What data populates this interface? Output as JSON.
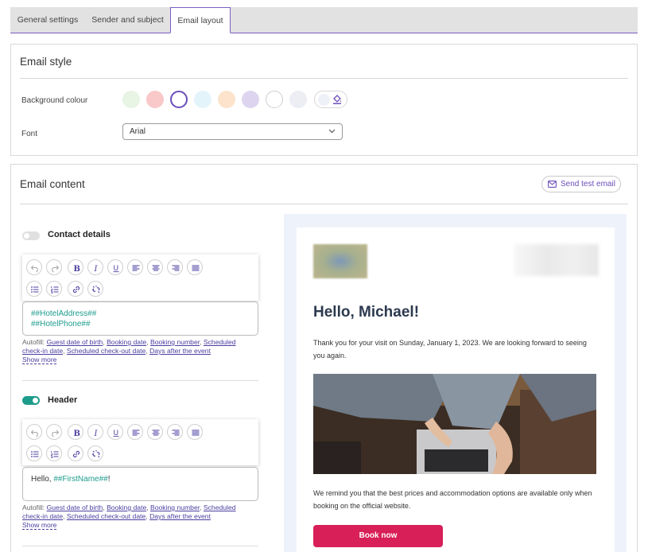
{
  "tabs": [
    {
      "label": "General settings"
    },
    {
      "label": "Sender and subject"
    },
    {
      "label": "Email layout"
    }
  ],
  "email_style": {
    "title": "Email style",
    "background_label": "Background colour",
    "swatch_colors": [
      "#e8f4e4",
      "#f9c8c8",
      "#ffffff",
      "#e4f4fb",
      "#fde3cc",
      "#ddd5ef",
      "#ffffff",
      "#eceef4"
    ],
    "font_label": "Font",
    "font_value": "Arial"
  },
  "email_content": {
    "title": "Email content",
    "send_test_label": "Send test email",
    "sections": [
      {
        "label": "Contact details",
        "enabled": false,
        "lines": [
          "##HotelAddress##",
          "##HotelPhone##"
        ]
      },
      {
        "label": "Header",
        "enabled": true,
        "text_prefix": "Hello, ",
        "var": "##FirstName##",
        "text_suffix": "!"
      }
    ],
    "autofill": {
      "label": "Autofill:",
      "items": [
        "Guest date of birth",
        "Booking date",
        "Booking number",
        "Scheduled check-in date",
        "Scheduled check-out date",
        "Days after the event"
      ],
      "show_more": "Show more"
    }
  },
  "preview": {
    "greeting": "Hello, Michael!",
    "intro": "Thank you for your visit on Sunday, January 1, 2023. We are looking forward to seeing you again.",
    "reminder": "We remind you that the best prices and accommodation options are available only when booking on the official website.",
    "button_label": "Book now"
  },
  "colors": {
    "accent": "#6b4fbb",
    "toggle_on": "#1d9c8c",
    "book_button": "#d81f57"
  }
}
